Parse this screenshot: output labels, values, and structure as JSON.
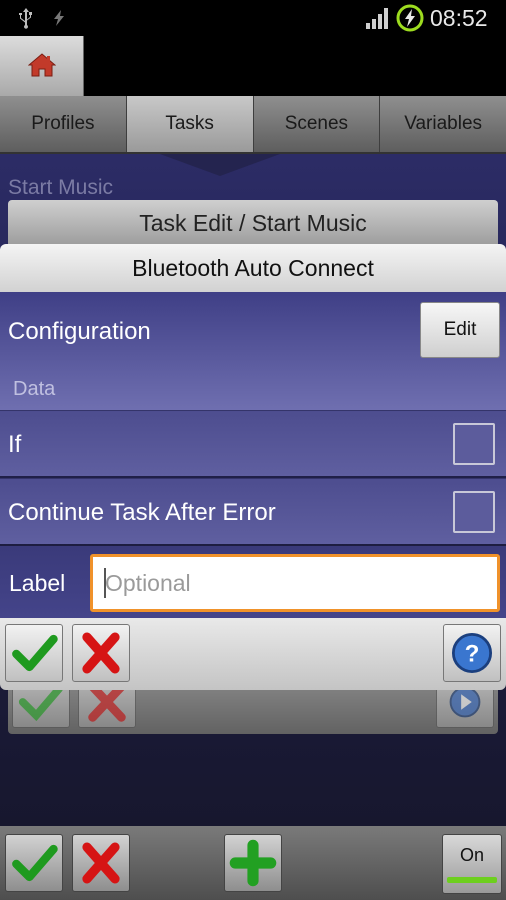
{
  "status_bar": {
    "time": "08:52"
  },
  "tabs": [
    {
      "label": "Profiles",
      "active": false
    },
    {
      "label": "Tasks",
      "active": true
    },
    {
      "label": "Scenes",
      "active": false
    },
    {
      "label": "Variables",
      "active": false
    }
  ],
  "background": {
    "task_name": "Start Music",
    "task_edit_title": "Task Edit / Start Music"
  },
  "dialog": {
    "title": "Bluetooth Auto Connect",
    "configuration_label": "Configuration",
    "edit_button": "Edit",
    "data_label": "Data",
    "if_label": "If",
    "if_checked": false,
    "continue_label": "Continue Task After Error",
    "continue_checked": false,
    "label_label": "Label",
    "label_value": "",
    "label_placeholder": "Optional"
  },
  "bottom_bar": {
    "on_label": "On"
  },
  "colors": {
    "accent_orange": "#f0922a",
    "panel_purple": "#4d4d8f",
    "toggle_green": "#6dcf1e"
  },
  "icons": {
    "status_left": [
      "usb-icon",
      "flash-icon"
    ],
    "status_right": [
      "signal-icon",
      "battery-charging-icon"
    ],
    "home": "home-icon",
    "accept": "check-icon",
    "cancel": "cross-icon",
    "help": "help-icon",
    "add": "plus-icon",
    "play": "play-icon"
  }
}
